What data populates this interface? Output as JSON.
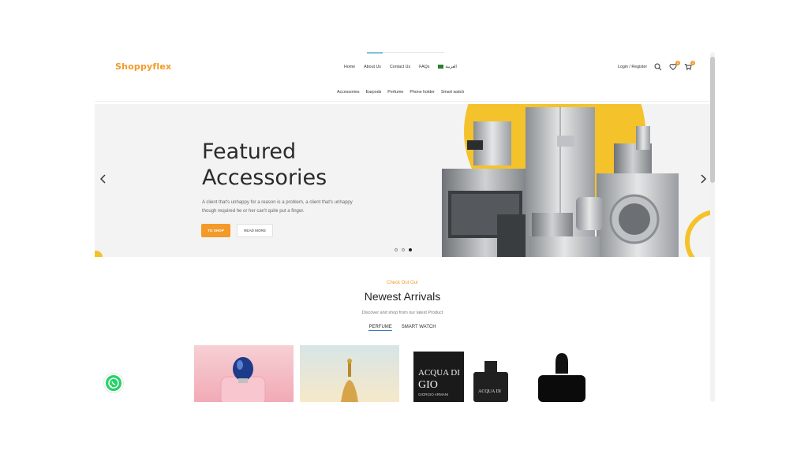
{
  "header": {
    "logo": "Shoppyflex",
    "nav": [
      "Home",
      "About Us",
      "Contact Us",
      "FAQs"
    ],
    "language": "العربية",
    "login_register": "Login / Register",
    "wishlist_count": "0",
    "cart_count": "0"
  },
  "categories": [
    "Accessories",
    "Earpods",
    "Perfume",
    "Phone holder",
    "Smart watch"
  ],
  "hero": {
    "title_line1": "Featured",
    "title_line2": "Accessories",
    "text": "A client that's unhappy for a reason is a problem, a client that's unhappy though required he or her can't quite put a finger.",
    "shop_label": "TO SHOP",
    "read_label": "READ MORE",
    "prev_icon": "chevron-left-icon",
    "next_icon": "chevron-right-icon",
    "slide_active": 3,
    "slide_total": 3
  },
  "newest": {
    "kicker": "Check Out Our",
    "title": "Newest Arrivals",
    "subtitle": "Discover and shop from our latest Product",
    "tabs": [
      "PERFUME",
      "SMART WATCH"
    ],
    "active_tab": "PERFUME",
    "product_texts": [
      "ACQUA DI",
      "GIO",
      "GIORGIO ARMANI",
      "ACQUA DI"
    ]
  },
  "colors": {
    "accent": "#f39a28",
    "yellow": "#f4c22b",
    "whatsapp": "#25d366"
  }
}
